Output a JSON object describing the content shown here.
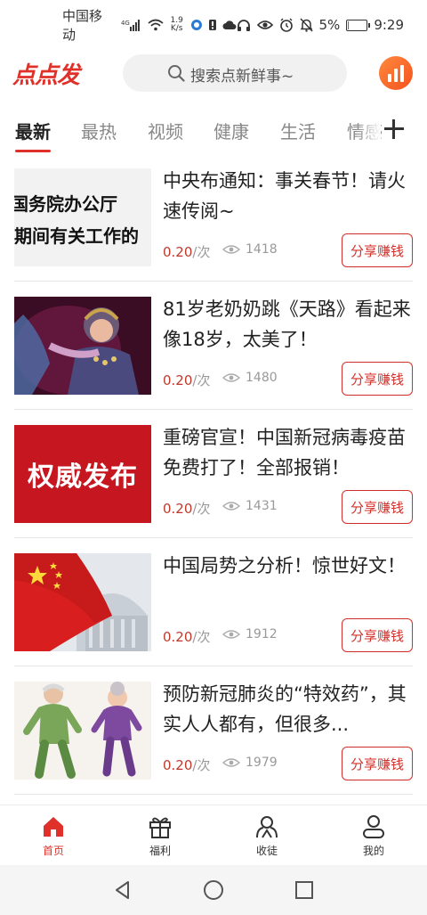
{
  "status_bar": {
    "carrier": "中国移动",
    "network": "4G",
    "speed_top": "1.9",
    "speed_bottom": "K/s",
    "battery": "5%",
    "battery_level": 0.05,
    "time": "9:29"
  },
  "header": {
    "logo": "点点发",
    "search_placeholder": "搜索点新鲜事~"
  },
  "tabs": [
    {
      "label": "最新",
      "active": true
    },
    {
      "label": "最热",
      "active": false
    },
    {
      "label": "视频",
      "active": false
    },
    {
      "label": "健康",
      "active": false
    },
    {
      "label": "生活",
      "active": false
    },
    {
      "label": "情感",
      "active": false
    }
  ],
  "feed": [
    {
      "title": "中央布通知：事关春节！请火速传阅~",
      "price": "0.20",
      "unit": "/次",
      "views": "1418",
      "share": "分享赚钱",
      "thumb_lines": [
        "国务院办公厅",
        "期间有关工作的"
      ]
    },
    {
      "title": "81岁老奶奶跳《天路》看起来像18岁，太美了！",
      "price": "0.20",
      "unit": "/次",
      "views": "1480",
      "share": "分享赚钱"
    },
    {
      "title": "重磅官宣！中国新冠病毒疫苗免费打了！全部报销！",
      "price": "0.20",
      "unit": "/次",
      "views": "1431",
      "share": "分享赚钱",
      "thumb_text": "权威发布"
    },
    {
      "title": "中国局势之分析！惊世好文！",
      "price": "0.20",
      "unit": "/次",
      "views": "1912",
      "share": "分享赚钱"
    },
    {
      "title": "预防新冠肺炎的“特效药”，其实人人都有，但很多...",
      "price": "0.20",
      "unit": "/次",
      "views": "1979",
      "share": "分享赚钱"
    }
  ],
  "bottom_nav": [
    {
      "label": "首页",
      "icon": "home-icon",
      "active": true
    },
    {
      "label": "福利",
      "icon": "gift-icon",
      "active": false
    },
    {
      "label": "收徒",
      "icon": "apprentice-icon",
      "active": false
    },
    {
      "label": "我的",
      "icon": "profile-icon",
      "active": false
    }
  ],
  "colors": {
    "accent": "#e0302a",
    "price": "#c0392b",
    "muted": "#999999"
  }
}
